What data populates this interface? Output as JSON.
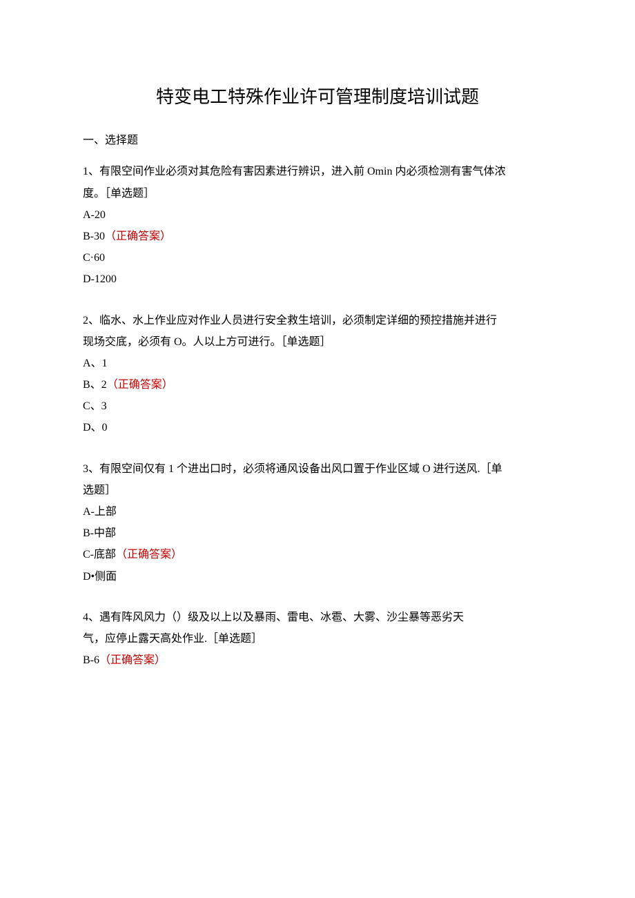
{
  "title": "特变电工特殊作业许可管理制度培训试题",
  "section": "一、选择题",
  "questions": [
    {
      "stem_1": "1、有限空间作业必须对其危险有害因素进行辨识，进入前 Omin 内必须检测有害气体浓",
      "stem_2": "度。［单选题］",
      "options": [
        {
          "label": "A-20",
          "correct": ""
        },
        {
          "label": "B-30",
          "correct": "（正确答案）"
        },
        {
          "label": "C·60",
          "correct": ""
        },
        {
          "label": "D-1200",
          "correct": ""
        }
      ]
    },
    {
      "stem_1": "2、临水、水上作业应对作业人员进行安全救生培训，必须制定详细的预控措施并进行",
      "stem_2": "现场交底，必须有 O。人以上方可进行。［单选题］",
      "options": [
        {
          "label": "A、1",
          "correct": ""
        },
        {
          "label": "B、2",
          "correct": "（正确答案）"
        },
        {
          "label": "C、3",
          "correct": ""
        },
        {
          "label": "D、0",
          "correct": ""
        }
      ]
    },
    {
      "stem_1": "3、有限空间仅有 1 个进出口时，必须将通风设备出风口置于作业区域 O 进行送风.［单",
      "stem_2": "选题］",
      "options": [
        {
          "label": "A-上部",
          "correct": ""
        },
        {
          "label": "B-中部",
          "correct": ""
        },
        {
          "label": "C-底部",
          "correct": "（正确答案）"
        },
        {
          "label": "D•侧面",
          "correct": ""
        }
      ]
    },
    {
      "stem_1": "4、遇有阵风风力（）级及以上以及暴雨、雷电、冰雹、大雾、沙尘暴等恶劣天",
      "stem_2": "气，应停止露天高处作业.［单选题］",
      "options": [
        {
          "label": "B-6",
          "correct": "（正确答案）"
        }
      ]
    }
  ]
}
